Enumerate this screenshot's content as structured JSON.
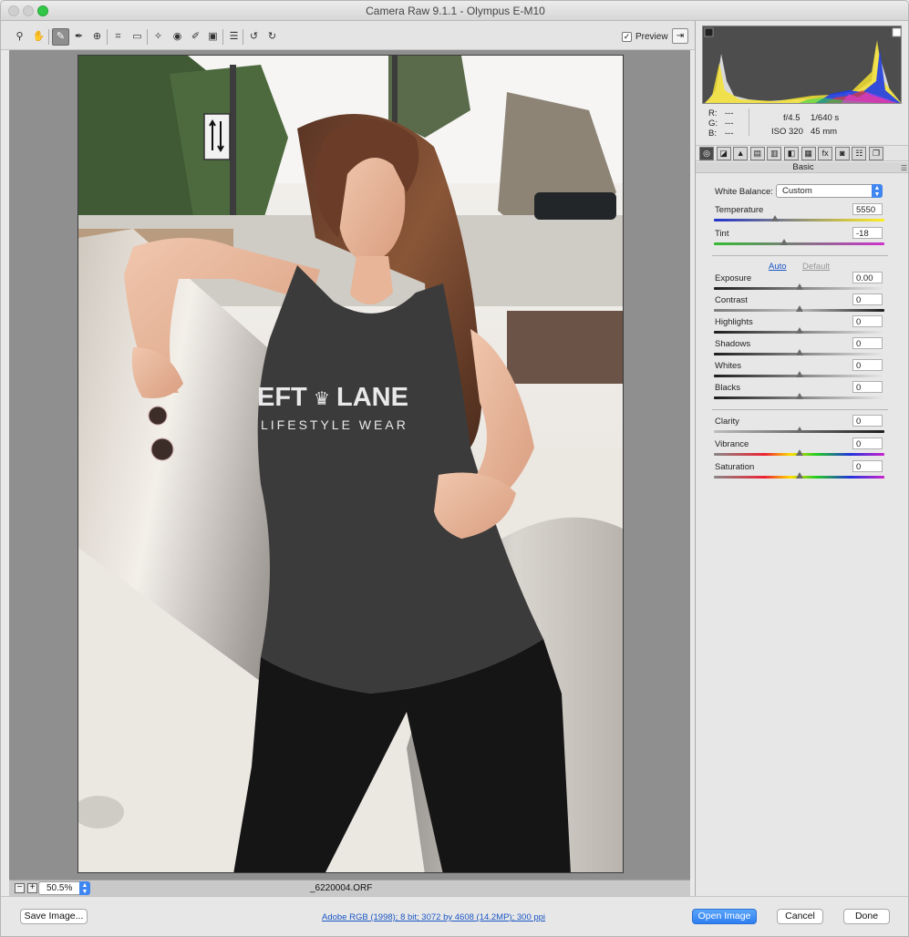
{
  "window": {
    "title": "Camera Raw 9.1.1  -  Olympus E-M10"
  },
  "toolbar": {
    "tools": [
      {
        "name": "zoom-tool-icon",
        "glyph": "⚲"
      },
      {
        "name": "hand-tool-icon",
        "glyph": "✋"
      },
      {
        "name": "white-balance-tool-icon",
        "glyph": "✎"
      },
      {
        "name": "color-sampler-tool-icon",
        "glyph": "✒"
      },
      {
        "name": "targeted-adjustment-tool-icon",
        "glyph": "⊕"
      },
      {
        "name": "crop-tool-icon",
        "glyph": "⌗"
      },
      {
        "name": "straighten-tool-icon",
        "glyph": "▭"
      },
      {
        "name": "spot-removal-tool-icon",
        "glyph": "✧"
      },
      {
        "name": "red-eye-removal-tool-icon",
        "glyph": "◉"
      },
      {
        "name": "adjustment-brush-icon",
        "glyph": "✐"
      },
      {
        "name": "graduated-filter-icon",
        "glyph": "▣"
      },
      {
        "name": "preferences-icon",
        "glyph": "☰"
      },
      {
        "name": "rotate-left-icon",
        "glyph": "↺"
      },
      {
        "name": "rotate-right-icon",
        "glyph": "↻"
      }
    ],
    "preview_label": "Preview",
    "preview_checked": "✓"
  },
  "status": {
    "zoom": "50.5%",
    "filename": "_6220004.ORF",
    "zoom_out": "−",
    "zoom_in": "+"
  },
  "readout": {
    "r_label": "R:",
    "g_label": "G:",
    "b_label": "B:",
    "r_value": "---",
    "g_value": "---",
    "b_value": "---",
    "aperture": "f/4.5",
    "shutter": "1/640 s",
    "iso": "ISO 320",
    "focal": "45 mm"
  },
  "panel_tabs": [
    "◎",
    "◪",
    "▲",
    "▤",
    "▥",
    "◧",
    "▦",
    "fx",
    "◙",
    "☷",
    "❐"
  ],
  "basic": {
    "title": "Basic",
    "wb_label": "White Balance:",
    "wb_value": "Custom",
    "auto_label": "Auto",
    "default_label": "Default",
    "sliders": [
      {
        "label": "Temperature",
        "value": "5550",
        "level": 0.36,
        "track": "linear-gradient(90deg,#2233cc,#ffee22)"
      },
      {
        "label": "Tint",
        "value": "-18",
        "level": 0.41,
        "track": "linear-gradient(90deg,#33bb33,#cc33cc)"
      },
      {
        "label": "Exposure",
        "value": "0.00",
        "level": 0.5,
        "track": "linear-gradient(90deg,#1d1d1d,#e8e8e8)"
      },
      {
        "label": "Contrast",
        "value": "0",
        "level": 0.5,
        "track": "linear-gradient(90deg,#7c7c7c,#bcbcbc 50%,#1d1d1d)"
      },
      {
        "label": "Highlights",
        "value": "0",
        "level": 0.5,
        "track": "linear-gradient(90deg,#1d1d1d,#e8e8e8)"
      },
      {
        "label": "Shadows",
        "value": "0",
        "level": 0.5,
        "track": "linear-gradient(90deg,#1d1d1d,#e8e8e8)"
      },
      {
        "label": "Whites",
        "value": "0",
        "level": 0.5,
        "track": "linear-gradient(90deg,#1d1d1d,#e8e8e8)"
      },
      {
        "label": "Blacks",
        "value": "0",
        "level": 0.5,
        "track": "linear-gradient(90deg,#1d1d1d,#e8e8e8)"
      },
      {
        "label": "Clarity",
        "value": "0",
        "level": 0.5,
        "track": "linear-gradient(90deg,#bdbdbd,#1d1d1d)"
      },
      {
        "label": "Vibrance",
        "value": "0",
        "level": 0.5,
        "track": "linear-gradient(90deg,#888,#e23 30%,#fd0 45%,#2c2 60%,#23d 80%,#c2c)"
      },
      {
        "label": "Saturation",
        "value": "0",
        "level": 0.5,
        "track": "linear-gradient(90deg,#888,#e23 30%,#fd0 45%,#2c2 60%,#23d 80%,#c2c)"
      }
    ]
  },
  "photo": {
    "shirt_text_line1": "EFT",
    "shirt_text_crown": "♛",
    "shirt_text_line2": "LANE",
    "shirt_text_line3": "LIFESTYLE WEAR"
  },
  "bottom": {
    "save_label": "Save Image...",
    "workflow_label": "Adobe RGB (1998); 8 bit; 3072 by 4608 (14.2MP); 300 ppi",
    "open_label": "Open Image",
    "cancel_label": "Cancel",
    "done_label": "Done"
  }
}
